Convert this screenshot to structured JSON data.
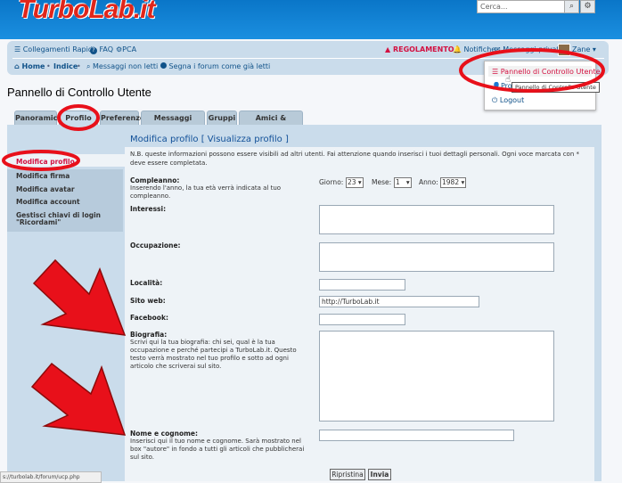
{
  "header": {
    "logo_text": "TurboLab.it",
    "search_placeholder": "Cerca..."
  },
  "nav": {
    "quick_links": "Collegamenti Rapidi",
    "faq": "FAQ",
    "pca": "PCA",
    "regolamento": "REGOLAMENTO",
    "notifiche": "Notifiche",
    "messaggi_privati": "Messaggi privati",
    "user": "Zane",
    "home": "Home",
    "indice": "Indice",
    "unread": "Messaggi non letti",
    "mark_read": "Segna i forum come già letti"
  },
  "dropdown": {
    "item1": "Pannello di Controllo Utente",
    "item2": "Pro",
    "item3": "Logout",
    "tooltip": "Pannello di Controllo Utente"
  },
  "page": {
    "title": "Pannello di Controllo Utente"
  },
  "tabs": [
    "Panoramica",
    "Profilo",
    "Preferenze",
    "Messaggi privati",
    "Gruppi",
    "Amici & Ignorati"
  ],
  "sidebar": {
    "items": [
      "Modifica profilo",
      "Modifica firma",
      "Modifica avatar",
      "Modifica account",
      "Gestisci chiavi di login",
      "\"Ricordami\""
    ]
  },
  "form": {
    "title_main": "Modifica profilo",
    "title_link": "Visualizza profilo",
    "note": "N.B. queste informazioni possono essere visibili ad altri utenti. Fai attenzione quando inserisci i tuoi dettagli personali. Ogni voce marcata con * deve essere completata.",
    "compleanno_label": "Compleanno:",
    "compleanno_hint": "Inserendo l'anno, la tua età verrà indicata al tuo compleanno.",
    "giorno_label": "Giorno:",
    "giorno_value": "23",
    "mese_label": "Mese:",
    "mese_value": "1",
    "anno_label": "Anno:",
    "anno_value": "1982",
    "interessi_label": "Interessi:",
    "occupazione_label": "Occupazione:",
    "localita_label": "Località:",
    "sito_label": "Sito web:",
    "sito_value": "http://TurboLab.it",
    "facebook_label": "Facebook:",
    "biografia_label": "Biografia:",
    "biografia_hint": "Scrivi qui la tua biografia: chi sei, qual è la tua occupazione e perché partecipi a TurboLab.it. Questo testo verrà mostrato nel tuo profilo e sotto ad ogni articolo che scriverai sul sito.",
    "nome_label": "Nome e cognome:",
    "nome_hint": "Inserisci qui il tuo nome e cognome. Sarà mostrato nel box \"autore\" in fondo a tutti gli articoli che pubblicherai sul sito.",
    "reset_button": "Ripristina",
    "submit_button": "Invia"
  },
  "statusbar": "s://turbolab.it/forum/ucp.php",
  "colors": {
    "header_blue": "#0a76c8",
    "nav_bg": "#cadceb",
    "annotation_red": "#e8101a",
    "logo_red": "#e0261b",
    "link_blue": "#105289"
  },
  "icons": [
    "bars-icon",
    "question-icon",
    "cogs-icon",
    "warning-icon",
    "bell-icon",
    "inbox-icon",
    "home-icon",
    "search-icon",
    "circle-icon",
    "power-icon",
    "caret-down-icon"
  ]
}
